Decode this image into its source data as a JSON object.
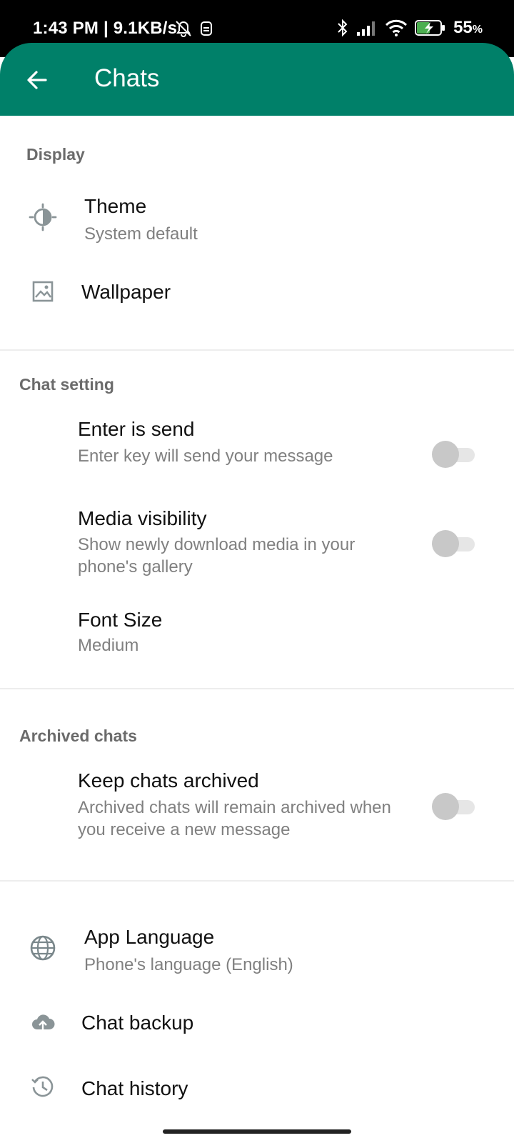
{
  "status_bar": {
    "time": "1:43 PM | 9.1KB/s",
    "battery_percent": "55",
    "battery_unit": "%"
  },
  "app_bar": {
    "title": "Chats",
    "back_icon": "arrow-left-icon"
  },
  "colors": {
    "accent": "#008069",
    "section_text": "#6b6b6b",
    "subtitle_text": "#808080"
  },
  "display": {
    "header": "Display",
    "theme": {
      "title": "Theme",
      "subtitle": "System default",
      "icon": "theme-icon"
    },
    "wallpaper": {
      "title": "Wallpaper",
      "icon": "wallpaper-icon"
    }
  },
  "chat_setting": {
    "header": "Chat setting",
    "enter_is_send": {
      "title": "Enter is send",
      "subtitle": "Enter key will send your message",
      "enabled": false
    },
    "media_visibility": {
      "title": "Media visibility",
      "subtitle_line1": "Show newly download media in your",
      "subtitle_line2": "phone's gallery",
      "enabled": false
    },
    "font_size": {
      "title": "Font Size",
      "subtitle": "Medium"
    }
  },
  "archived_chats": {
    "header": "Archived chats",
    "keep_archived": {
      "title": "Keep chats archived",
      "subtitle_line1": "Archived chats will remain archived when",
      "subtitle_line2": "you receive a new message",
      "enabled": false
    }
  },
  "more": {
    "app_language": {
      "title": "App Language",
      "subtitle": "Phone's language (English)",
      "icon": "globe-icon"
    },
    "chat_backup": {
      "title": "Chat backup",
      "icon": "cloud-upload-icon"
    },
    "chat_history": {
      "title": "Chat history",
      "icon": "history-icon"
    }
  }
}
